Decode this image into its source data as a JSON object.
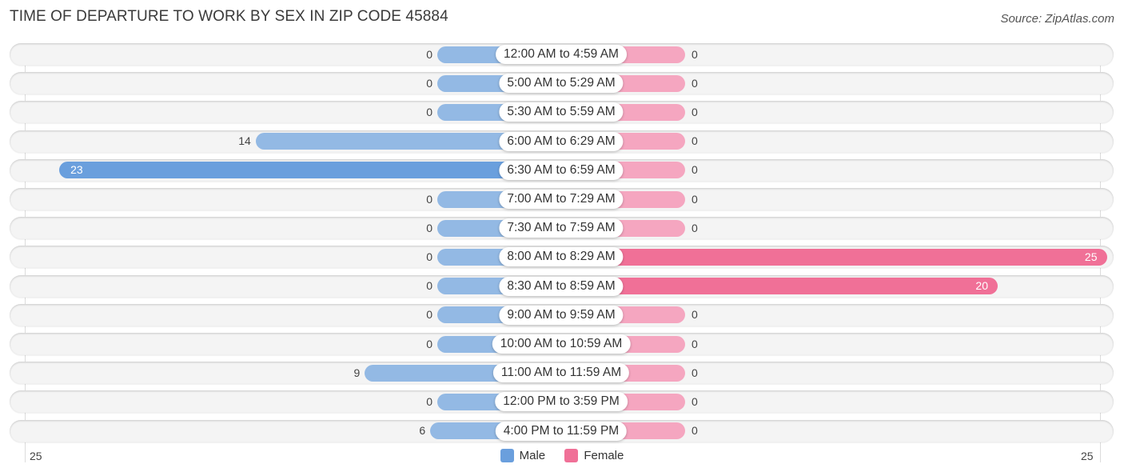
{
  "header": {
    "title": "TIME OF DEPARTURE TO WORK BY SEX IN ZIP CODE 45884",
    "source": "Source: ZipAtlas.com"
  },
  "colors": {
    "male": "#6a9fdd",
    "male_light": "#93b9e4",
    "female": "#f07097",
    "female_light": "#f5a6c0"
  },
  "chart_data": {
    "type": "bar",
    "orientation": "horizontal-diverging",
    "title": "TIME OF DEPARTURE TO WORK BY SEX IN ZIP CODE 45884",
    "categories": [
      "12:00 AM to 4:59 AM",
      "5:00 AM to 5:29 AM",
      "5:30 AM to 5:59 AM",
      "6:00 AM to 6:29 AM",
      "6:30 AM to 6:59 AM",
      "7:00 AM to 7:29 AM",
      "7:30 AM to 7:59 AM",
      "8:00 AM to 8:29 AM",
      "8:30 AM to 8:59 AM",
      "9:00 AM to 9:59 AM",
      "10:00 AM to 10:59 AM",
      "11:00 AM to 11:59 AM",
      "12:00 PM to 3:59 PM",
      "4:00 PM to 11:59 PM"
    ],
    "series": [
      {
        "name": "Male",
        "values": [
          0,
          0,
          0,
          14,
          23,
          0,
          0,
          0,
          0,
          0,
          0,
          9,
          0,
          6
        ]
      },
      {
        "name": "Female",
        "values": [
          0,
          0,
          0,
          0,
          0,
          0,
          0,
          25,
          20,
          0,
          0,
          0,
          0,
          0
        ]
      }
    ],
    "axis": {
      "left_max_label": "25",
      "right_max_label": "25",
      "range": [
        25,
        25
      ]
    },
    "legend": {
      "position": "bottom-center",
      "entries": [
        "Male",
        "Female"
      ]
    },
    "xlabel": "",
    "ylabel": ""
  }
}
